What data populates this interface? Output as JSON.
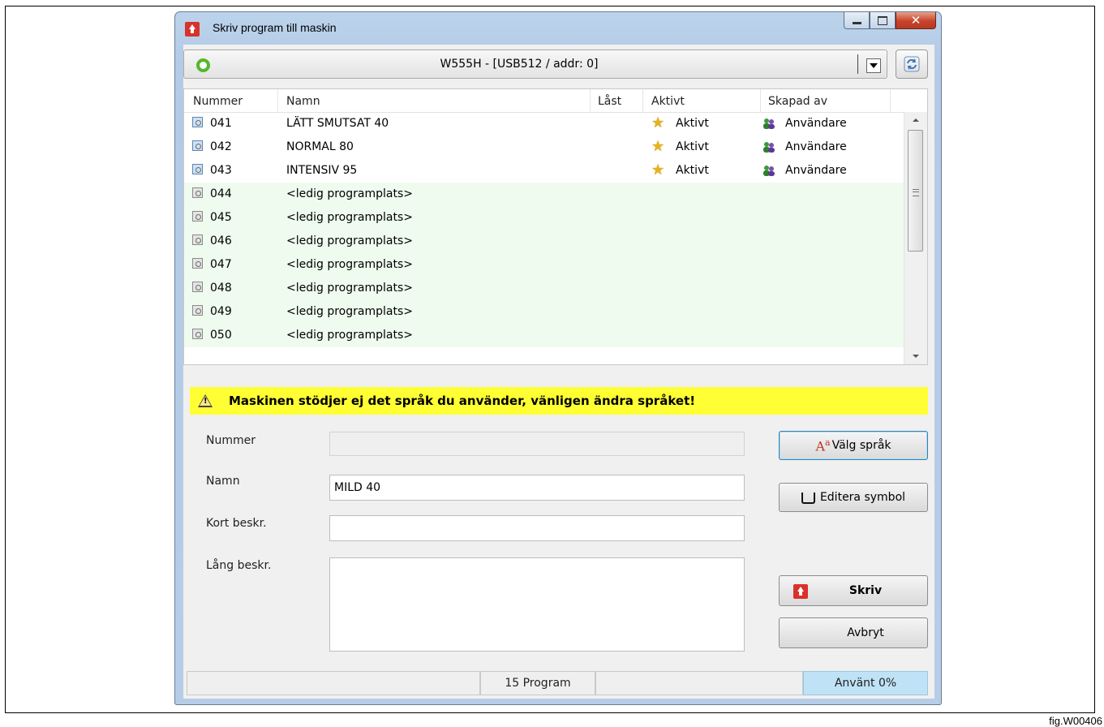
{
  "window": {
    "title": "Skriv program till maskin"
  },
  "machine": {
    "selected": "W555H - [USB512 / addr: 0]",
    "status_color": "#54b82a"
  },
  "list": {
    "columns": [
      "Nummer",
      "Namn",
      "Låst",
      "Aktivt",
      "Skapad av"
    ],
    "rows": [
      {
        "number": "041",
        "name": "LÄTT SMUTSAT 40",
        "locked": "",
        "active": "Aktivt",
        "created_by": "Användare",
        "state": "used"
      },
      {
        "number": "042",
        "name": "NORMAL 80",
        "locked": "",
        "active": "Aktivt",
        "created_by": "Användare",
        "state": "used"
      },
      {
        "number": "043",
        "name": "INTENSIV 95",
        "locked": "",
        "active": "Aktivt",
        "created_by": "Användare",
        "state": "used"
      },
      {
        "number": "044",
        "name": "<ledig programplats>",
        "locked": "",
        "active": "",
        "created_by": "",
        "state": "empty"
      },
      {
        "number": "045",
        "name": "<ledig programplats>",
        "locked": "",
        "active": "",
        "created_by": "",
        "state": "empty"
      },
      {
        "number": "046",
        "name": "<ledig programplats>",
        "locked": "",
        "active": "",
        "created_by": "",
        "state": "empty"
      },
      {
        "number": "047",
        "name": "<ledig programplats>",
        "locked": "",
        "active": "",
        "created_by": "",
        "state": "empty"
      },
      {
        "number": "048",
        "name": "<ledig programplats>",
        "locked": "",
        "active": "",
        "created_by": "",
        "state": "empty"
      },
      {
        "number": "049",
        "name": "<ledig programplats>",
        "locked": "",
        "active": "",
        "created_by": "",
        "state": "empty"
      },
      {
        "number": "050",
        "name": "<ledig programplats>",
        "locked": "",
        "active": "",
        "created_by": "",
        "state": "empty"
      }
    ]
  },
  "warning": {
    "text": "Maskinen stödjer ej det språk du använder, vänligen ändra språket!"
  },
  "form": {
    "number_label": "Nummer",
    "number_value": "",
    "name_label": "Namn",
    "name_value": "MILD 40",
    "short_label": "Kort beskr.",
    "short_value": "",
    "long_label": "Lång beskr.",
    "long_value": ""
  },
  "buttons": {
    "language": "Välg språk",
    "symbol": "Editera symbol",
    "write": "Skriv",
    "cancel": "Avbryt"
  },
  "statusbar": {
    "count": "15 Program",
    "used": "Använt 0%"
  },
  "figure_label": "fig.W00406",
  "colors": {
    "warning_bg": "#ffff33",
    "empty_row_bg": "#effbef",
    "used_panel": "#bfe2f6",
    "accent_red": "#d8322b"
  }
}
